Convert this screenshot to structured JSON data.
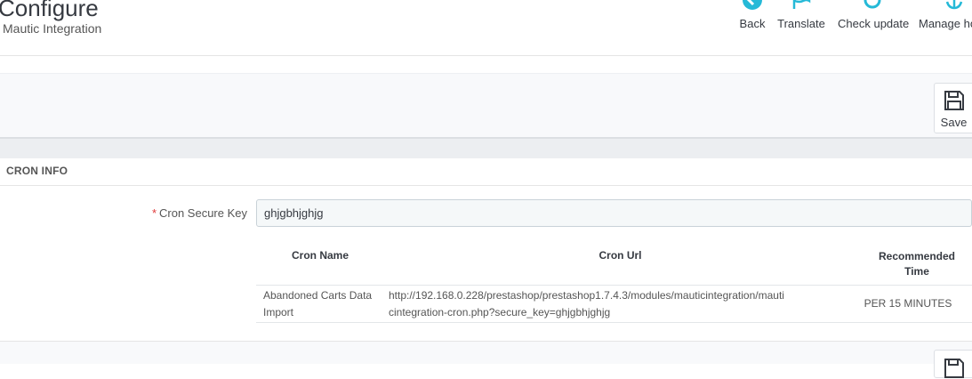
{
  "header": {
    "title": "Configure",
    "subtitle": "Mautic Integration"
  },
  "toolbar": {
    "back_label": "Back",
    "translate_label": "Translate",
    "check_update_label": "Check update",
    "manage_hooks_label": "Manage ho"
  },
  "actions": {
    "save_label": "Save"
  },
  "cron_panel": {
    "heading": "CRON INFO",
    "secure_key_label": "Cron Secure Key",
    "secure_key_value": "ghjgbhjghjg",
    "table": {
      "headers": [
        "Cron Name",
        "Cron Url",
        "Recommended Time"
      ],
      "rows": [
        {
          "name": "Abandoned Carts Data Import",
          "url": "http://192.168.0.228/prestashop/prestashop1.7.4.3/modules/mauticintegration/mauticintegration-cron.php?secure_key=ghjgbhjghjg",
          "time": "PER 15 MINUTES"
        }
      ]
    }
  },
  "colors": {
    "icon_blue": "#25b9d7",
    "required_red": "#e03838"
  }
}
